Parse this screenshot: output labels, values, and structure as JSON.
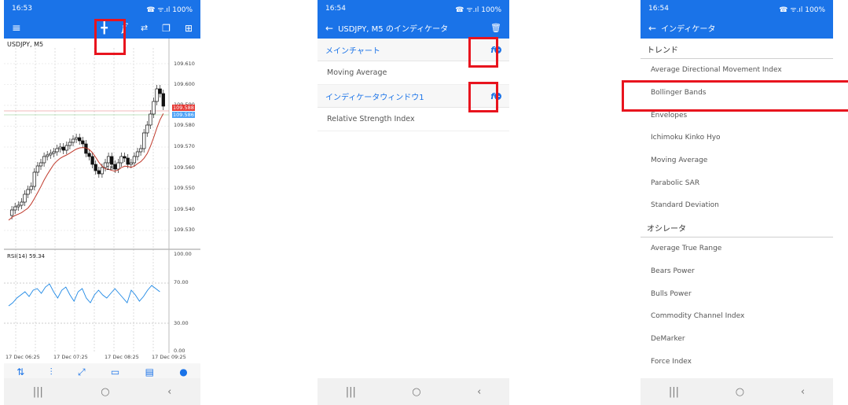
{
  "phone1": {
    "status_time": "16:53",
    "status_right": "☎ ᯤ.ıl 100%",
    "symbol": "USDJPY, M5",
    "price_labels": [
      "109.610",
      "109.600",
      "109.590",
      "109.580",
      "109.570",
      "109.560",
      "109.550",
      "109.540",
      "109.530"
    ],
    "bid_tag": "109.588",
    "ask_tag": "109.586",
    "rsi_label": "RSI(14) 59.34",
    "rsi_levels": [
      "100.00",
      "70.00",
      "30.00",
      "0.00"
    ],
    "time_labels": [
      "17 Dec 06:25",
      "17 Dec 07:25",
      "17 Dec 08:25",
      "17 Dec 09:25"
    ],
    "chart_marker": "18",
    "toolbar_icons": [
      "quotes-icon",
      "chart-icon",
      "trade-icon",
      "history-icon",
      "news-icon",
      "chat-icon"
    ]
  },
  "phone2": {
    "status_time": "16:54",
    "status_right": "☎ ᯤ.ıl 100%",
    "title": "USDJPY, M5 のインディケータ",
    "sections": [
      {
        "label": "メインチャート",
        "items": [
          "Moving Average"
        ]
      },
      {
        "label": "インディケータウィンドウ1",
        "items": [
          "Relative Strength Index"
        ]
      }
    ]
  },
  "phone3": {
    "status_time": "16:54",
    "status_right": "☎ ᯤ.ıl 100%",
    "title": "インディケータ",
    "groups": [
      {
        "label": "トレンド",
        "items": [
          "Average Directional Movement Index",
          "Bollinger Bands",
          "Envelopes",
          "Ichimoku Kinko Hyo",
          "Moving Average",
          "Parabolic SAR",
          "Standard Deviation"
        ]
      },
      {
        "label": "オシレータ",
        "items": [
          "Average True Range",
          "Bears Power",
          "Bulls Power",
          "Commodity Channel Index",
          "DeMarker",
          "Force Index"
        ]
      }
    ]
  },
  "colors": {
    "accent": "#1a73e8",
    "highlight": "#e8141e",
    "ma_line": "#c0392b",
    "rsi_line": "#1e88e5"
  }
}
